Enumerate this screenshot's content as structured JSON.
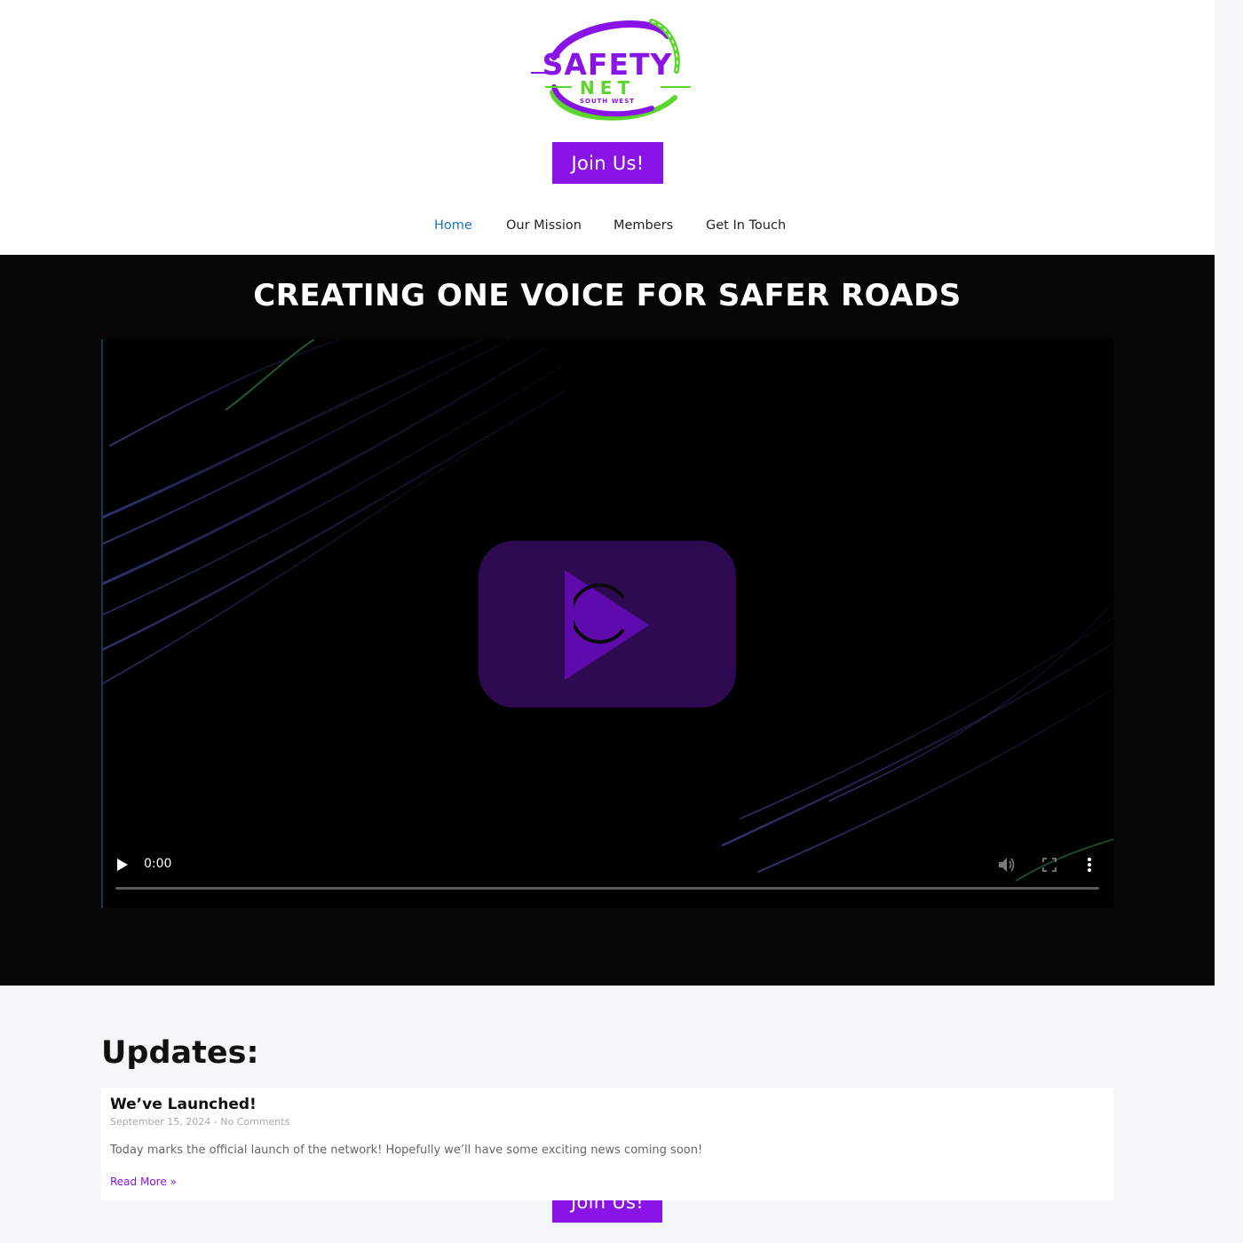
{
  "header": {
    "logo": {
      "text_main": "SAFETY",
      "text_sub": "NET",
      "text_small": "SOUTH WEST"
    },
    "join_label": "Join Us!"
  },
  "nav": {
    "items": [
      {
        "label": "Home"
      },
      {
        "label": "Our Mission"
      },
      {
        "label": "Members"
      },
      {
        "label": "Get In Touch"
      }
    ]
  },
  "hero": {
    "title": "CREATING ONE VOICE FOR SAFER ROADS",
    "video": {
      "time": "0:00",
      "progress": 0
    },
    "join_label": "Join Us!"
  },
  "updates": {
    "heading": "Updates:",
    "posts": [
      {
        "title": "We’ve Launched!",
        "meta": "September 15, 2024 - No Comments",
        "excerpt": "Today marks the official launch of the network! Hopefully we’ll have some exciting news coming soon!",
        "read_more": "Read More »"
      }
    ]
  },
  "colors": {
    "brand_purple": "#8a14e8",
    "brand_green": "#5bd62b",
    "nav_active": "#1e73be",
    "hero_bg": "#060606",
    "page_bg": "#f5f6f8"
  },
  "icons": [
    "play-icon",
    "volume-icon",
    "fullscreen-icon",
    "more-options-icon",
    "loading-spinner-icon"
  ]
}
